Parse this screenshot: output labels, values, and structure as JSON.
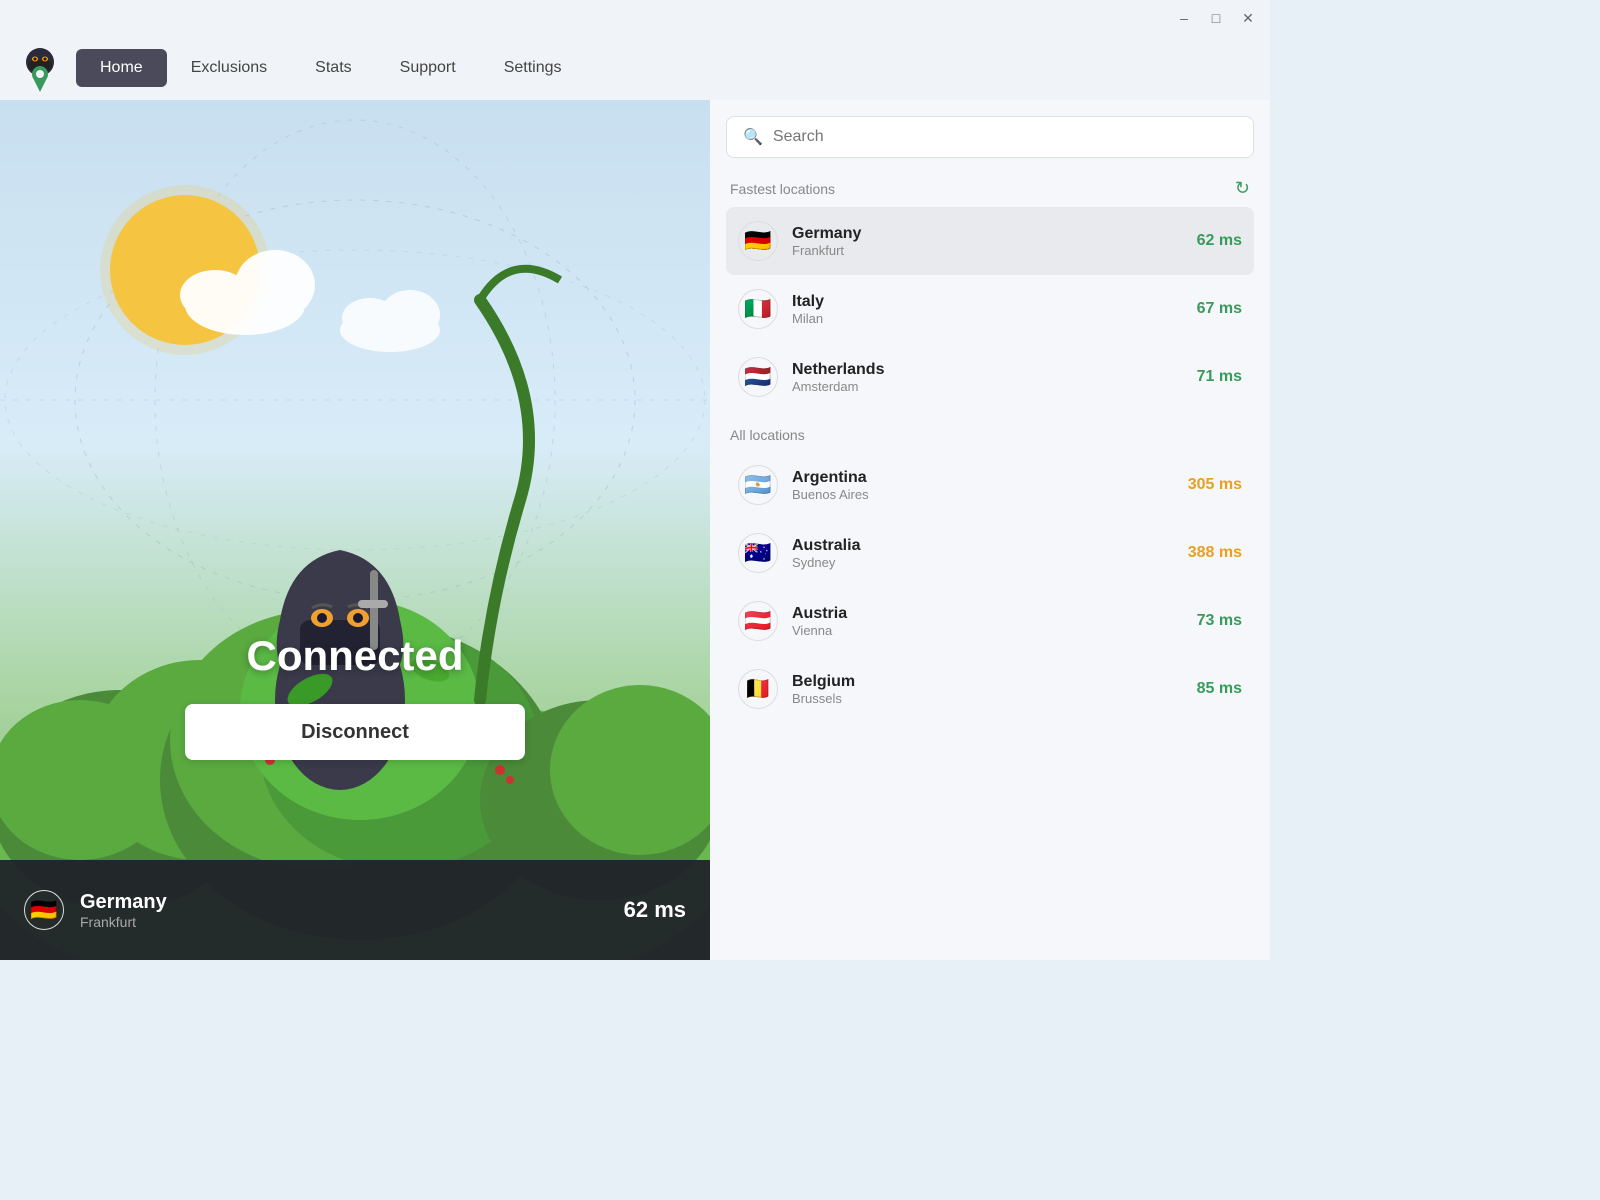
{
  "titleBar": {
    "minimizeLabel": "–",
    "maximizeLabel": "□",
    "closeLabel": "✕"
  },
  "nav": {
    "logoAlt": "VPN Ninja Logo",
    "tabs": [
      {
        "id": "home",
        "label": "Home",
        "active": true
      },
      {
        "id": "exclusions",
        "label": "Exclusions",
        "active": false
      },
      {
        "id": "stats",
        "label": "Stats",
        "active": false
      },
      {
        "id": "support",
        "label": "Support",
        "active": false
      },
      {
        "id": "settings",
        "label": "Settings",
        "active": false
      }
    ]
  },
  "leftPanel": {
    "status": "Connected",
    "disconnectLabel": "Disconnect",
    "statusBar": {
      "country": "Germany",
      "city": "Frankfurt",
      "ms": "62 ms"
    }
  },
  "rightPanel": {
    "search": {
      "placeholder": "Search"
    },
    "fastestLocations": {
      "sectionTitle": "Fastest locations",
      "items": [
        {
          "country": "Germany",
          "city": "Frankfurt",
          "ms": "62 ms",
          "msClass": "ms-green",
          "flag": "🇩🇪",
          "selected": true
        },
        {
          "country": "Italy",
          "city": "Milan",
          "ms": "67 ms",
          "msClass": "ms-green",
          "flag": "🇮🇹",
          "selected": false
        },
        {
          "country": "Netherlands",
          "city": "Amsterdam",
          "ms": "71 ms",
          "msClass": "ms-green",
          "flag": "🇳🇱",
          "selected": false
        }
      ]
    },
    "allLocations": {
      "sectionTitle": "All locations",
      "items": [
        {
          "country": "Argentina",
          "city": "Buenos Aires",
          "ms": "305 ms",
          "msClass": "ms-orange",
          "flag": "🇦🇷",
          "selected": false
        },
        {
          "country": "Australia",
          "city": "Sydney",
          "ms": "388 ms",
          "msClass": "ms-orange",
          "flag": "🇦🇺",
          "selected": false
        },
        {
          "country": "Austria",
          "city": "Vienna",
          "ms": "73 ms",
          "msClass": "ms-green",
          "flag": "🇦🇹",
          "selected": false
        },
        {
          "country": "Belgium",
          "city": "Brussels",
          "ms": "85 ms",
          "msClass": "ms-green",
          "flag": "🇧🇪",
          "selected": false
        }
      ]
    }
  }
}
